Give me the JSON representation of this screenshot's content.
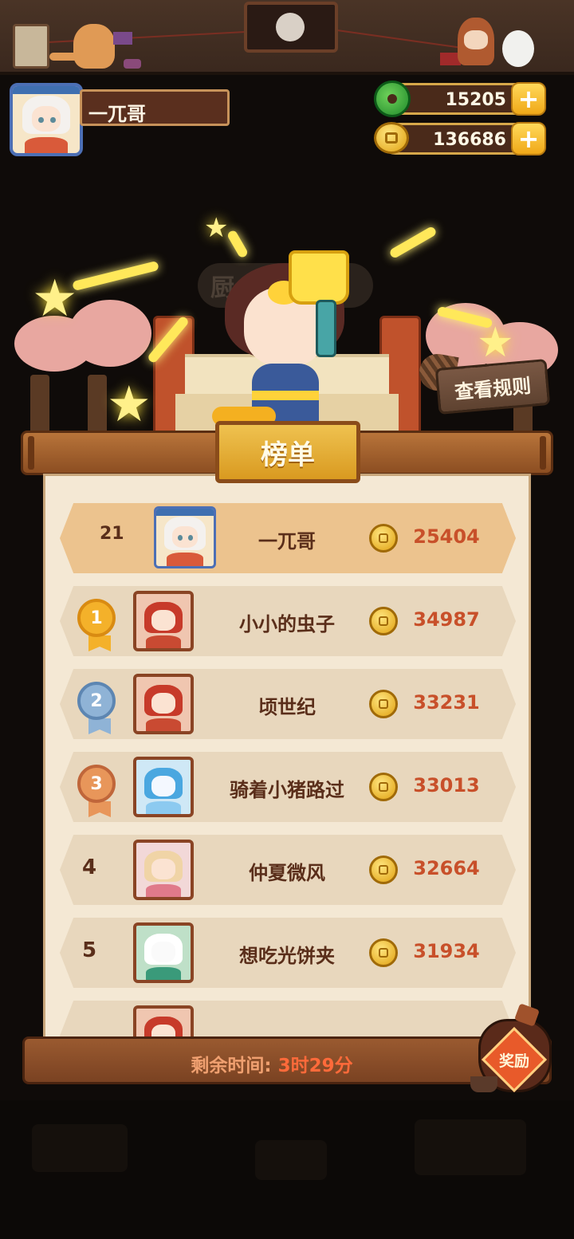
{
  "player": {
    "name": "一兀哥"
  },
  "resources": {
    "jade": "15205",
    "coins": "136686"
  },
  "scene": {
    "sign": "厨  榜"
  },
  "buttons": {
    "rules": "查看规则",
    "plus": "+",
    "reward": "奖励"
  },
  "board": {
    "title": "榜单",
    "me": {
      "rank": "21",
      "name": "一兀哥",
      "score": "25404"
    },
    "rows": [
      {
        "rank": "1",
        "name": "小小的虫子",
        "score": "34987",
        "medal": "gold",
        "avatar": "av-red"
      },
      {
        "rank": "2",
        "name": "顷世纪",
        "score": "33231",
        "medal": "silver",
        "avatar": "av-red"
      },
      {
        "rank": "3",
        "name": "骑着小猪路过",
        "score": "33013",
        "medal": "bronze",
        "avatar": "av-blue"
      },
      {
        "rank": "4",
        "name": "仲夏微风",
        "score": "32664",
        "medal": "",
        "avatar": "av-pink"
      },
      {
        "rank": "5",
        "name": "想吃光饼夹",
        "score": "31934",
        "medal": "",
        "avatar": "av-panda"
      }
    ]
  },
  "timer": {
    "label": "剩余时间: ",
    "value": "3时29分"
  },
  "icons": {
    "jade": "jade-icon",
    "coin": "coin-icon",
    "plus": "plus-icon",
    "star": "star-icon",
    "medal": "medal-icon",
    "reward": "reward-jar-icon"
  },
  "colors": {
    "score": "#c8502a",
    "panel": "#f4e8d4",
    "accent_gold": "#f0a818",
    "timer_value": "#ff6a3a"
  }
}
